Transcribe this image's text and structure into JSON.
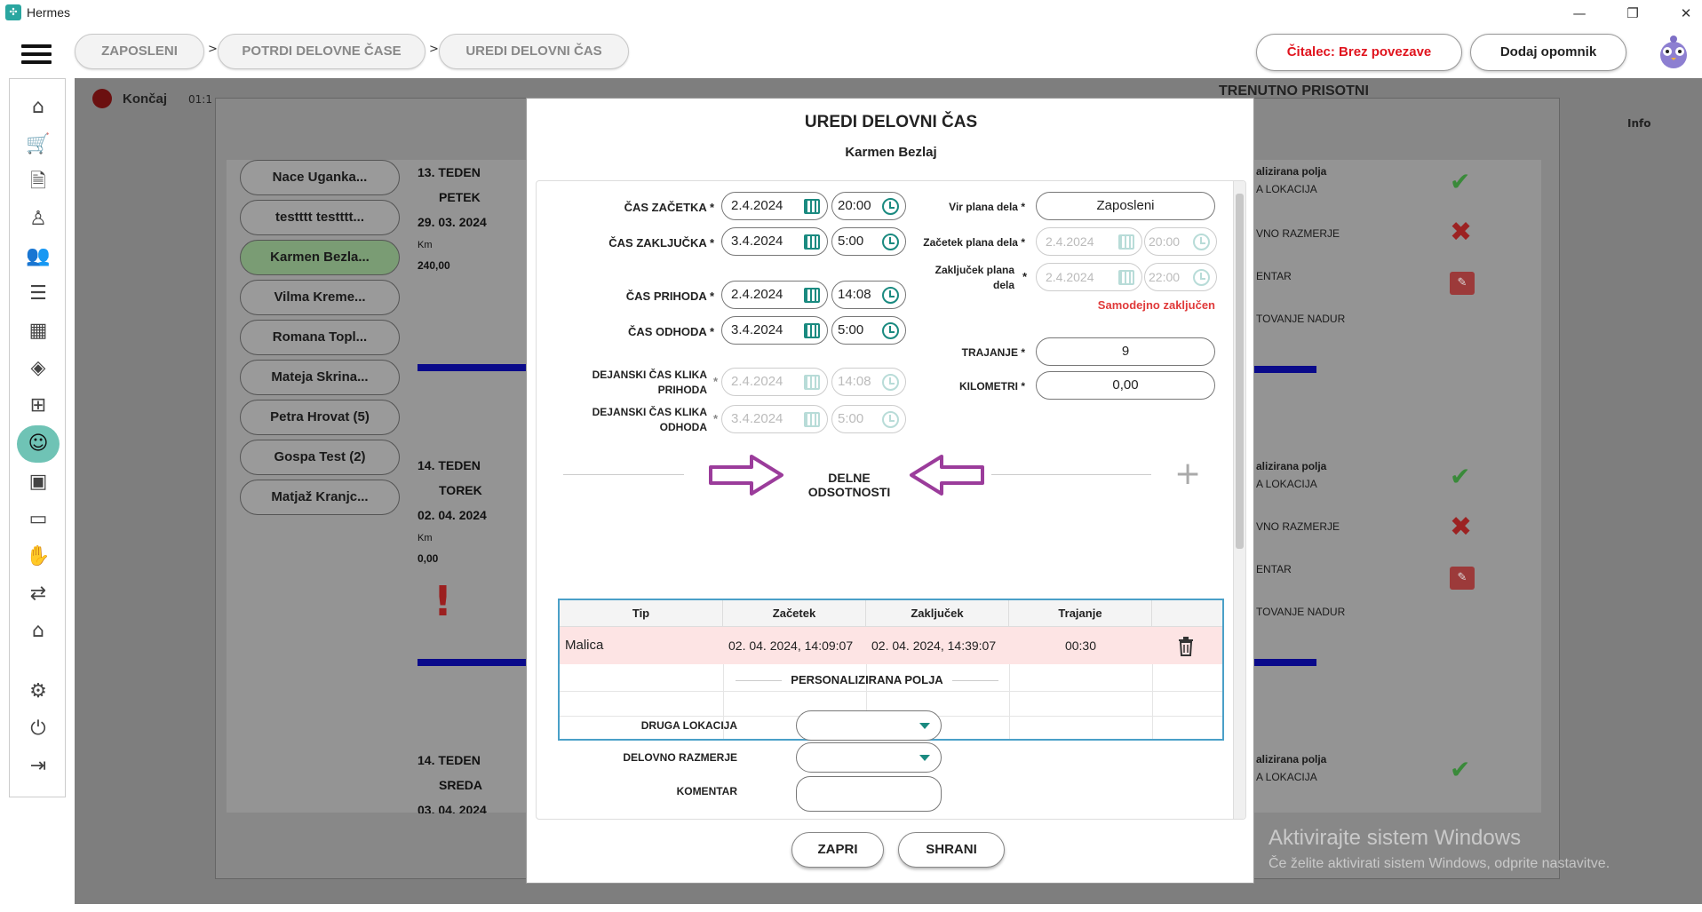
{
  "window": {
    "app_name": "Hermes",
    "minimize": "—",
    "maximize": "❐",
    "close": "✕"
  },
  "breadcrumb": [
    "ZAPOSLENI",
    "POTRDI DELOVNE ČASE",
    "UREDI DELOVNI ČAS"
  ],
  "crumb_sep": ">",
  "header": {
    "reader_status": "Čitalec: Brez povezave",
    "add_reminder": "Dodaj opomnik"
  },
  "colors": {
    "accent": "#1a8a80",
    "reader_red": "#e0141e",
    "active_green": "#6fc3b5",
    "danger": "#e03a3a",
    "grid_border": "#4aa0c8",
    "absence_row": "#fde4e4"
  },
  "sidebar": {
    "icons": [
      "home-icon",
      "cart-icon",
      "document-icon",
      "person-icon",
      "people-icon",
      "list-icon",
      "calendar-icon",
      "layers-icon",
      "org-chart-icon",
      "employee-badge-icon",
      "briefcase-icon",
      "chat-icon",
      "handshake-icon",
      "route-icon",
      "home-user-icon",
      "gear-icon",
      "power-icon",
      "logout-icon"
    ]
  },
  "background": {
    "finish_btn": "Končaj",
    "time_stub": "01:1",
    "present_title": "TRENUTNO PRISOTNI",
    "info_col": "Info",
    "employees": [
      "Nace Uganka...",
      "testttt testttt...",
      "Karmen Bezla...",
      "Vilma Kreme...",
      "Romana Topl...",
      "Mateja Skrina...",
      "Petra Hrovat (5)",
      "Gospa Test (2)",
      "Matjaž Kranjc..."
    ],
    "days": [
      {
        "week": "13. TEDEN",
        "weekday": "PETEK",
        "date": "29. 03. 2024",
        "km_label": "Km",
        "km": "240,00"
      },
      {
        "week": "14. TEDEN",
        "weekday": "TOREK",
        "date": "02. 04. 2024",
        "km_label": "Km",
        "km": "0,00"
      },
      {
        "week": "14. TEDEN",
        "weekday": "SREDA",
        "date": "03. 04. 2024"
      }
    ],
    "right_labels": [
      "alizirana polja",
      "A LOKACIJA",
      "VNO RAZMERJE",
      "ENTAR",
      "TOVANJE NADUR"
    ],
    "watermark_title": "Aktivirajte sistem Windows",
    "watermark_sub": "Če želite aktivirati sistem Windows, odprite nastavitve."
  },
  "modal": {
    "title": "UREDI DELOVNI ČAS",
    "employee": "Karmen Bezlaj",
    "fields": {
      "start": {
        "label": "ČAS ZAČETKA",
        "date": "2.4.2024",
        "time": "20:00"
      },
      "end": {
        "label": "ČAS ZAKLJUČKA",
        "date": "3.4.2024",
        "time": "5:00"
      },
      "arrival": {
        "label": "ČAS PRIHODA",
        "date": "2.4.2024",
        "time": "14:08"
      },
      "departure": {
        "label": "ČAS ODHODA",
        "date": "3.4.2024",
        "time": "5:00"
      },
      "actual_arrival": {
        "label_1": "DEJANSKI ČAS KLIKA",
        "label_2": "PRIHODA",
        "date": "2.4.2024",
        "time": "14:08"
      },
      "actual_departure": {
        "label_1": "DEJANSKI ČAS KLIKA",
        "label_2": "ODHODA",
        "date": "3.4.2024",
        "time": "5:00"
      },
      "plan_source": {
        "label": "Vir plana dela",
        "value": "Zaposleni"
      },
      "plan_start": {
        "label": "Začetek plana dela",
        "date": "2.4.2024",
        "time": "20:00"
      },
      "plan_end": {
        "label_1": "Zaključek plana",
        "label_2": "dela",
        "date": "2.4.2024",
        "time": "22:00"
      },
      "auto_closed": "Samodejno zaključen",
      "duration": {
        "label": "TRAJANJE",
        "value": "9"
      },
      "km": {
        "label": "KILOMETRI",
        "value": "0,00"
      },
      "required": "*"
    },
    "absences": {
      "title": "DELNE ODSOTNOSTI",
      "columns": [
        "Tip",
        "Začetek",
        "Zaključek",
        "Trajanje"
      ],
      "rows": [
        {
          "type": "Malica",
          "start": "02. 04. 2024, 14:09:07",
          "end": "02. 04. 2024, 14:39:07",
          "duration": "00:30"
        }
      ]
    },
    "custom": {
      "title": "PERSONALIZIRANA POLJA",
      "location_label": "DRUGA LOKACIJA",
      "ratio_label": "DELOVNO RAZMERJE",
      "comment_label": "KOMENTAR"
    },
    "close_btn": "ZAPRI",
    "save_btn": "SHRANI"
  }
}
